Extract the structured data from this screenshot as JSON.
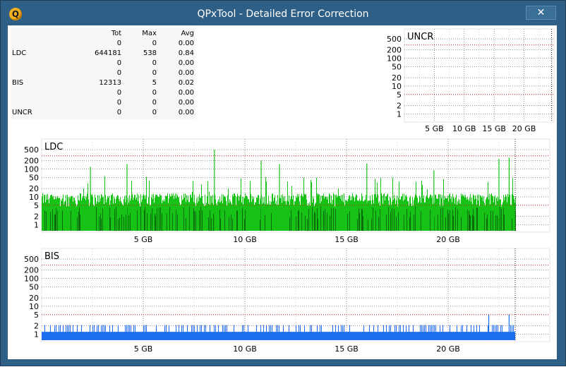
{
  "window": {
    "title": "QPxTool - Detailed Error Correction",
    "close_glyph": "✕",
    "app_icon_letter": "Q"
  },
  "stats": {
    "headers": [
      "",
      "Tot",
      "Max",
      "Avg"
    ],
    "rows": [
      [
        "",
        "0",
        "0",
        "0.00"
      ],
      [
        "LDC",
        "644181",
        "538",
        "0.84"
      ],
      [
        "",
        "0",
        "0",
        "0.00"
      ],
      [
        "",
        "0",
        "0",
        "0.00"
      ],
      [
        "BIS",
        "12313",
        "5",
        "0.02"
      ],
      [
        "",
        "0",
        "0",
        "0.00"
      ],
      [
        "",
        "0",
        "0",
        "0.00"
      ],
      [
        "UNCR",
        "0",
        "0",
        "0.00"
      ]
    ]
  },
  "chart_data": [
    {
      "type": "bar",
      "title": "UNCR",
      "scale": "log",
      "y_ticks": [
        "500",
        "200",
        "100",
        "50",
        "20",
        "10",
        "5",
        "2",
        "1"
      ],
      "x_ticks": [
        "5 GB",
        "10 GB",
        "15 GB",
        "20 GB"
      ],
      "x_range_gb": [
        0,
        25
      ],
      "threshold_lines": [
        300,
        5
      ],
      "values": []
    },
    {
      "type": "bar",
      "title": "LDC",
      "scale": "log",
      "y_ticks": [
        "500",
        "200",
        "100",
        "50",
        "20",
        "10",
        "5",
        "2",
        "1"
      ],
      "x_ticks": [
        "5 GB",
        "10 GB",
        "15 GB",
        "20 GB"
      ],
      "x_range_gb": [
        0,
        25
      ],
      "data_end_gb": 23.3,
      "threshold_lines": [
        300,
        5
      ],
      "typical_level": 10,
      "peaks": [
        {
          "x": 2.4,
          "y": 120
        },
        {
          "x": 4.2,
          "y": 150
        },
        {
          "x": 8.5,
          "y": 500
        },
        {
          "x": 10.8,
          "y": 200
        },
        {
          "x": 11.7,
          "y": 150
        },
        {
          "x": 16.0,
          "y": 160
        },
        {
          "x": 19.3,
          "y": 90
        },
        {
          "x": 22.5,
          "y": 230
        },
        {
          "x": 23.0,
          "y": 260
        }
      ],
      "colors": {
        "light": "#16c216",
        "dark": "#0a6b0a",
        "threshold": "#c02020"
      }
    },
    {
      "type": "bar",
      "title": "BIS",
      "scale": "log",
      "y_ticks": [
        "500",
        "200",
        "100",
        "50",
        "20",
        "10",
        "5",
        "2",
        "1"
      ],
      "x_ticks": [
        "5 GB",
        "10 GB",
        "15 GB",
        "20 GB"
      ],
      "x_range_gb": [
        0,
        25
      ],
      "data_end_gb": 23.3,
      "threshold_lines": [
        300,
        5
      ],
      "typical_level": 1,
      "peaks": [
        {
          "x": 22.0,
          "y": 5
        },
        {
          "x": 23.0,
          "y": 5
        }
      ],
      "colors": {
        "bar": "#1d6ef0",
        "threshold": "#c02020"
      }
    }
  ]
}
